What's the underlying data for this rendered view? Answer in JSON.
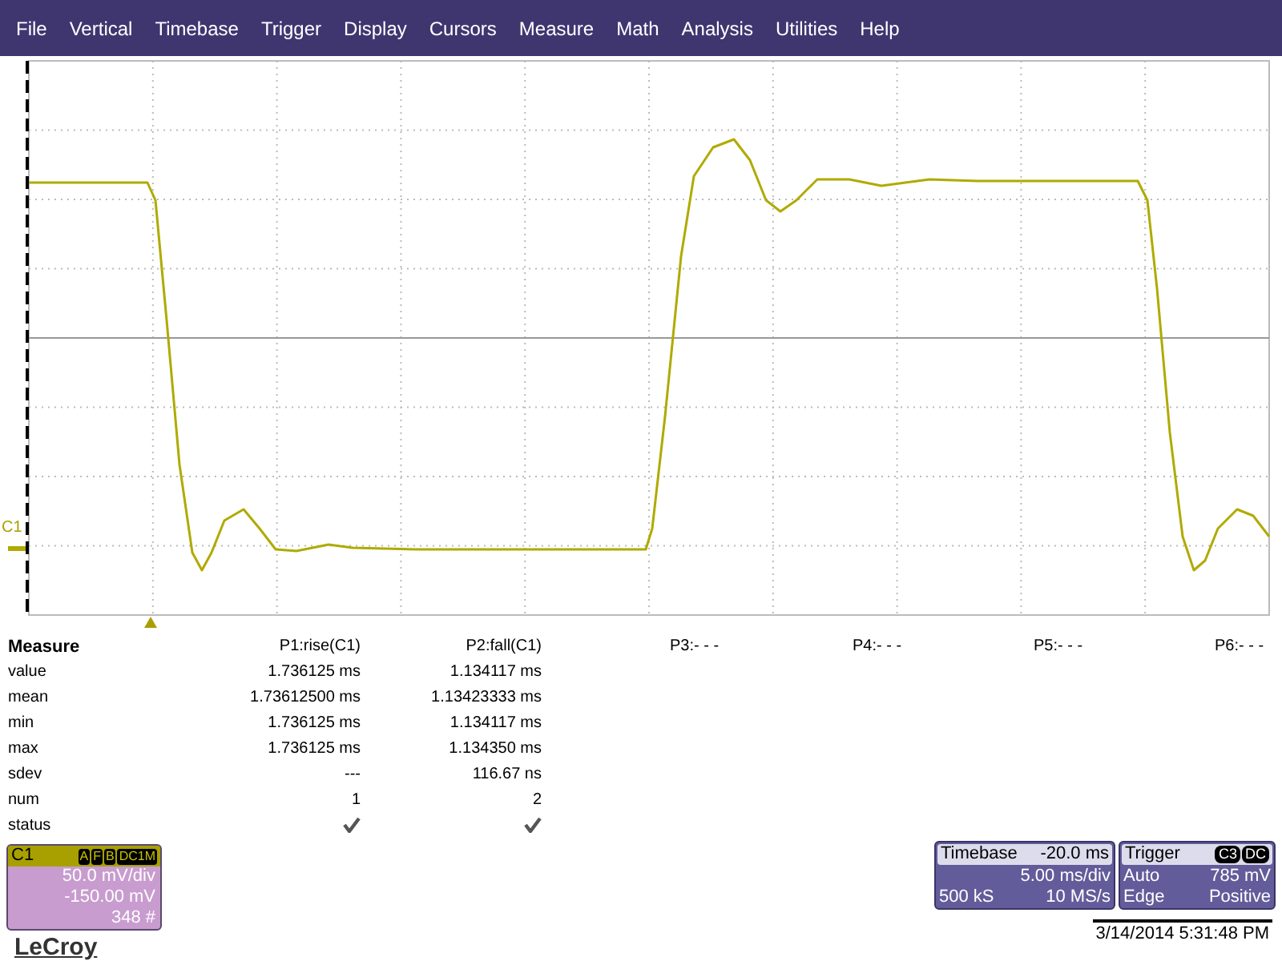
{
  "menu": [
    "File",
    "Vertical",
    "Timebase",
    "Trigger",
    "Display",
    "Cursors",
    "Measure",
    "Math",
    "Analysis",
    "Utilities",
    "Help"
  ],
  "plot": {
    "channel_label": "C1"
  },
  "measure": {
    "title": "Measure",
    "row_labels": [
      "value",
      "mean",
      "min",
      "max",
      "sdev",
      "num",
      "status"
    ],
    "columns": [
      {
        "header": "P1:rise(C1)",
        "cells": [
          "1.736125 ms",
          "1.73612500 ms",
          "1.736125 ms",
          "1.736125 ms",
          "---",
          "1"
        ],
        "status_ok": true
      },
      {
        "header": "P2:fall(C1)",
        "cells": [
          "1.134117 ms",
          "1.13423333 ms",
          "1.134117 ms",
          "1.134350 ms",
          "116.67 ns",
          "2"
        ],
        "status_ok": true
      },
      {
        "header": "P3:- - -"
      },
      {
        "header": "P4:- - -"
      },
      {
        "header": "P5:- - -"
      },
      {
        "header": "P6:- - -"
      }
    ]
  },
  "channel": {
    "label": "C1",
    "badges": [
      "A",
      "F",
      "B",
      "DC1M"
    ],
    "lines": [
      "50.0 mV/div",
      "-150.00 mV",
      "348 #"
    ]
  },
  "timebase": {
    "title": "Timebase",
    "delay": "-20.0 ms",
    "scale": "5.00 ms/div",
    "samples": "500 kS",
    "rate": "10 MS/s"
  },
  "trigger": {
    "title": "Trigger",
    "badges": [
      "C3",
      "DC"
    ],
    "mode": "Auto",
    "level": "785 mV",
    "type": "Edge",
    "slope": "Positive"
  },
  "brand": "LeCroy",
  "datetime": "3/14/2014 5:31:48 PM"
}
